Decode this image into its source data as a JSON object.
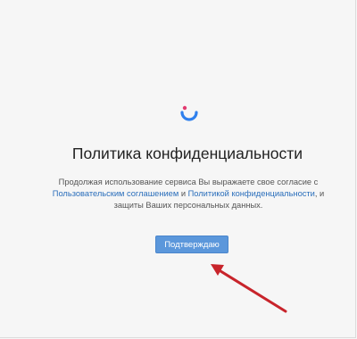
{
  "page": {
    "title": "Политика конфиденциальности",
    "body": {
      "line1_prefix": "Продолжая использование сервиса Вы выражаете свое согласие с",
      "link_terms": "Пользовательским соглашением",
      "conj": "и",
      "link_privacy": "Политикой конфиденциальности",
      "line2_suffix": ", и",
      "line3": "защиты Ваших персональных данных."
    },
    "confirm_label": "Подтверждаю"
  },
  "icons": {
    "logo": "smile-logo-icon",
    "annotation": "red-arrow-icon"
  },
  "colors": {
    "background": "#f6f6f6",
    "button": "#5b97db",
    "link": "#2a6ebb",
    "logo_blue": "#2f80ed",
    "logo_pink": "#e23b70",
    "arrow": "#c8242b"
  }
}
